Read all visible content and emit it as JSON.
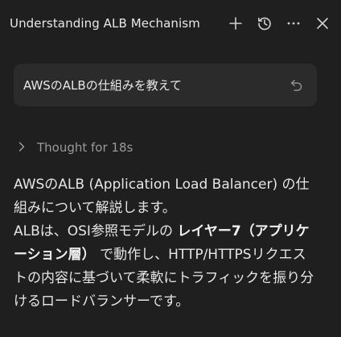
{
  "header": {
    "title": "Understanding ALB Mechanism",
    "icons": [
      "plus-icon",
      "history-icon",
      "more-icon",
      "close-icon"
    ]
  },
  "user_message": {
    "text": "AWSのALBの仕組みを教えて",
    "icon": "undo-icon"
  },
  "thought": {
    "label": "Thought for 18s",
    "icon": "chevron-right-icon"
  },
  "answer": {
    "p1": "AWSのALB (Application Load Balancer) の仕組みについて解説します。",
    "p2_before": "ALBは、OSI参照モデルの ",
    "p2_bold": "レイヤー7（アプリケーション層）",
    "p2_after": " で動作し、HTTP/HTTPSリクエストの内容に基づいて柔軟にトラフィックを振り分けるロードバランサーです。"
  },
  "colors": {
    "background": "#1f1f1f",
    "bubble": "#2b2b2b",
    "text": "#e6e6e6",
    "muted": "#9a9a9a"
  }
}
